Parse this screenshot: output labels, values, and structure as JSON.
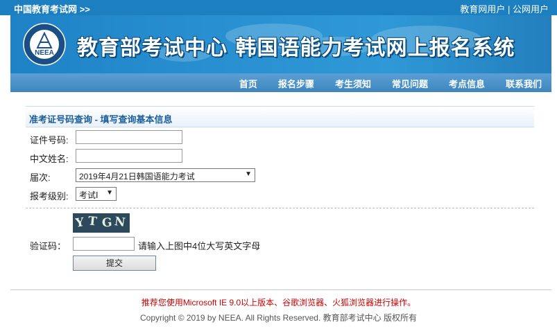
{
  "topbar": {
    "site_link": "中国教育考试网 >>",
    "user_links": [
      "教育网用户",
      "公网用户"
    ],
    "separator": "|"
  },
  "banner": {
    "logo_text": "NEEA",
    "title": "教育部考试中心  韩国语能力考试网上报名系统"
  },
  "nav": {
    "items": [
      "首页",
      "报名步骤",
      "考生须知",
      "常见问题",
      "考点信息",
      "联系我们"
    ]
  },
  "form": {
    "heading": "准考证号码查询 - 填写查询基本信息",
    "id_label": "证件号码:",
    "id_value": "",
    "name_label": "中文姓名:",
    "name_value": "",
    "session_label": "届次:",
    "session_selected": "2019年4月21日韩国语能力考试",
    "level_label": "报考级别:",
    "level_selected": "考试Ⅰ",
    "captcha_chars": [
      "Y",
      "T",
      "G",
      "N"
    ],
    "captcha_label": "验证码：",
    "captcha_value": "",
    "captcha_hint": "请输入上图中4位大写英文字母",
    "submit_label": "提交"
  },
  "footer": {
    "notice": "推荐您使用Microsoft IE 9.0以上版本、谷歌浏览器、火狐浏览器进行操作。",
    "copyright": "Copyright © 2019 by NEEA. All Rights Reserved. 教育部考试中心 版权所有"
  },
  "colors": {
    "topbar": "#1b7fc0",
    "banner": "#2a92d2",
    "nav": "#4a8fc6",
    "heading_text": "#1b5e9b",
    "notice_text": "#d10000"
  }
}
